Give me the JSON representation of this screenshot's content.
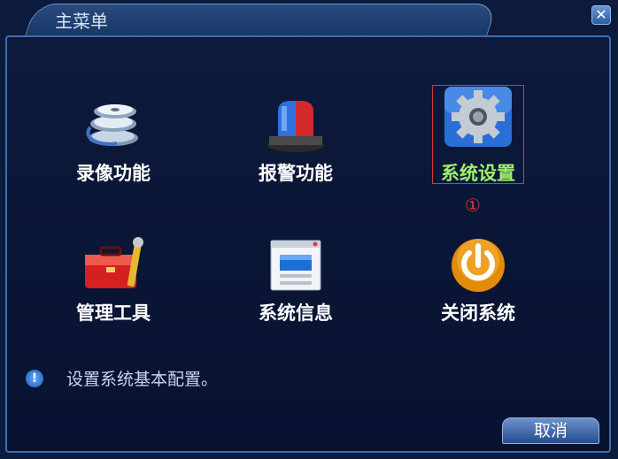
{
  "window": {
    "title": "主菜单"
  },
  "menu": [
    {
      "label": "录像功能",
      "icon": "film-reel-icon"
    },
    {
      "label": "报警功能",
      "icon": "alarm-siren-icon"
    },
    {
      "label": "系统设置",
      "icon": "gear-icon"
    },
    {
      "label": "管理工具",
      "icon": "toolbox-icon"
    },
    {
      "label": "系统信息",
      "icon": "system-info-window-icon"
    },
    {
      "label": "关闭系统",
      "icon": "power-icon"
    }
  ],
  "selected_index": 2,
  "annotation": {
    "marker": "①",
    "color": "#d63b2f"
  },
  "hint": {
    "text": "设置系统基本配置。"
  },
  "buttons": {
    "cancel": "取消"
  },
  "colors": {
    "selected_label": "#9ff06a",
    "frame": "#3f6cb0"
  }
}
